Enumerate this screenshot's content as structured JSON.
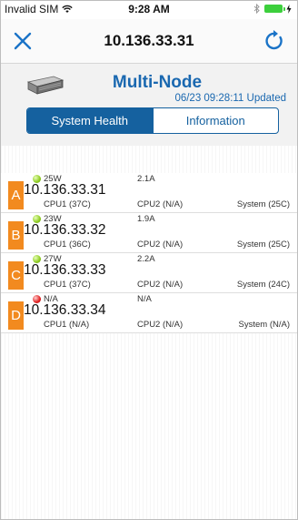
{
  "status_bar": {
    "carrier": "Invalid SIM",
    "time": "9:28 AM"
  },
  "nav": {
    "title": "10.136.33.31",
    "close_icon": "close-icon",
    "refresh_icon": "refresh-icon"
  },
  "header": {
    "model": "Multi-Node",
    "updated": "06/23 09:28:11 Updated",
    "tabs": [
      {
        "label": "System Health",
        "active": true
      },
      {
        "label": "Information",
        "active": false
      }
    ]
  },
  "nodes": [
    {
      "letter": "A",
      "status": "green",
      "power": "25W",
      "current": "2.1A",
      "ip": "10.136.33.31",
      "cpu1": "CPU1 (37C)",
      "cpu2": "CPU2 (N/A)",
      "system": "System (25C)"
    },
    {
      "letter": "B",
      "status": "green",
      "power": "23W",
      "current": "1.9A",
      "ip": "10.136.33.32",
      "cpu1": "CPU1 (36C)",
      "cpu2": "CPU2 (N/A)",
      "system": "System (25C)"
    },
    {
      "letter": "C",
      "status": "green",
      "power": "27W",
      "current": "2.2A",
      "ip": "10.136.33.33",
      "cpu1": "CPU1 (37C)",
      "cpu2": "CPU2 (N/A)",
      "system": "System (24C)"
    },
    {
      "letter": "D",
      "status": "red",
      "power": "N/A",
      "current": "N/A",
      "ip": "10.136.33.34",
      "cpu1": "CPU1 (N/A)",
      "cpu2": "CPU2 (N/A)",
      "system": "System (N/A)"
    }
  ],
  "colors": {
    "accent": "#15619f",
    "title_blue": "#1a68b0",
    "node_badge": "#f28a1f",
    "status_ok": "#8ecb22",
    "status_error": "#e12020",
    "battery": "#3ccf3c"
  }
}
